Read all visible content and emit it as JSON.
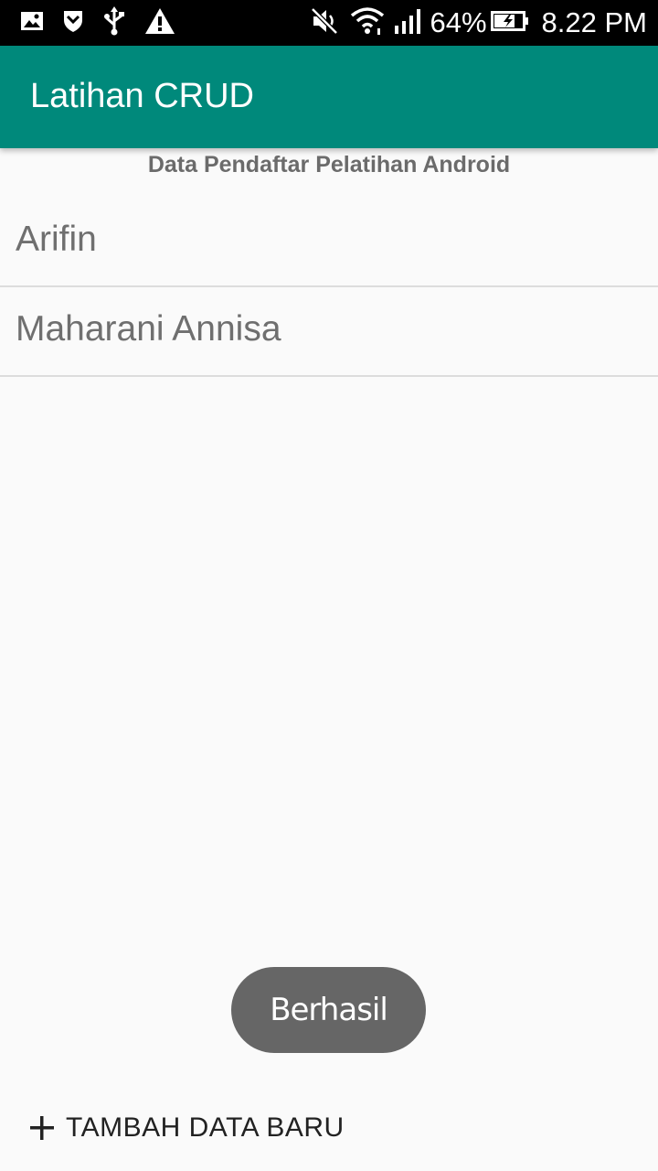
{
  "status_bar": {
    "icons_left": [
      "image-icon",
      "shield-icon",
      "usb-icon",
      "warning-icon"
    ],
    "icons_right": [
      "mute-icon",
      "wifi-icon",
      "signal-icon"
    ],
    "battery_percent": "64%",
    "time": "8.22 PM"
  },
  "app_bar": {
    "title": "Latihan CRUD",
    "color": "#00897b"
  },
  "list": {
    "header": "Data Pendaftar Pelatihan Android",
    "items": [
      {
        "name": "Arifin"
      },
      {
        "name": "Maharani Annisa"
      }
    ]
  },
  "toast": {
    "message": "Berhasil"
  },
  "actions": {
    "add_label": "TAMBAH DATA BARU",
    "add_icon": "plus-icon"
  }
}
